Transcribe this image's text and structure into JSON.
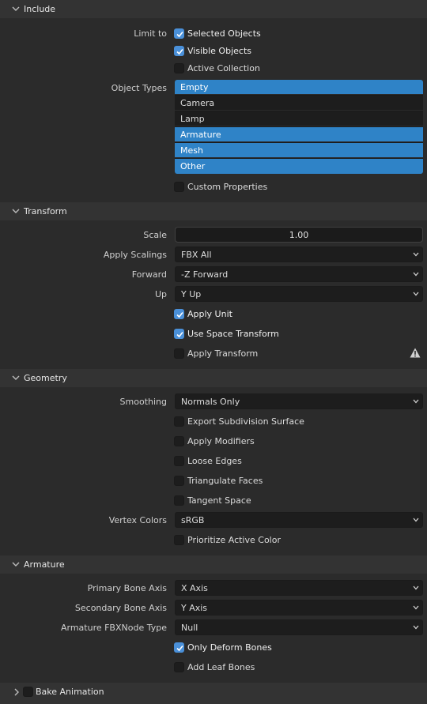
{
  "include": {
    "title": "Include",
    "limit_to_label": "Limit to",
    "selected_objects": {
      "label": "Selected Objects",
      "checked": true
    },
    "visible_objects": {
      "label": "Visible Objects",
      "checked": true
    },
    "active_collection": {
      "label": "Active Collection",
      "checked": false
    },
    "object_types_label": "Object Types",
    "object_types": [
      {
        "label": "Empty",
        "selected": true
      },
      {
        "label": "Camera",
        "selected": false
      },
      {
        "label": "Lamp",
        "selected": false
      },
      {
        "label": "Armature",
        "selected": true
      },
      {
        "label": "Mesh",
        "selected": true
      },
      {
        "label": "Other",
        "selected": true
      }
    ],
    "custom_properties": {
      "label": "Custom Properties",
      "checked": false
    }
  },
  "transform": {
    "title": "Transform",
    "scale_label": "Scale",
    "scale_value": "1.00",
    "apply_scalings_label": "Apply Scalings",
    "apply_scalings_value": "FBX All",
    "forward_label": "Forward",
    "forward_value": "-Z Forward",
    "up_label": "Up",
    "up_value": "Y Up",
    "apply_unit": {
      "label": "Apply Unit",
      "checked": true
    },
    "use_space_transform": {
      "label": "Use Space Transform",
      "checked": true
    },
    "apply_transform": {
      "label": "Apply Transform",
      "checked": false
    },
    "warning_icon": "warning-icon"
  },
  "geometry": {
    "title": "Geometry",
    "smoothing_label": "Smoothing",
    "smoothing_value": "Normals Only",
    "export_subdivision_surface": {
      "label": "Export Subdivision Surface",
      "checked": false
    },
    "apply_modifiers": {
      "label": "Apply Modifiers",
      "checked": false
    },
    "loose_edges": {
      "label": "Loose Edges",
      "checked": false
    },
    "triangulate_faces": {
      "label": "Triangulate Faces",
      "checked": false
    },
    "tangent_space": {
      "label": "Tangent Space",
      "checked": false
    },
    "vertex_colors_label": "Vertex Colors",
    "vertex_colors_value": "sRGB",
    "prioritize_active_color": {
      "label": "Prioritize Active Color",
      "checked": false
    }
  },
  "armature": {
    "title": "Armature",
    "primary_bone_axis_label": "Primary Bone Axis",
    "primary_bone_axis_value": "X Axis",
    "secondary_bone_axis_label": "Secondary Bone Axis",
    "secondary_bone_axis_value": "Y Axis",
    "fbxnode_type_label": "Armature FBXNode Type",
    "fbxnode_type_value": "Null",
    "only_deform_bones": {
      "label": "Only Deform Bones",
      "checked": true
    },
    "add_leaf_bones": {
      "label": "Add Leaf Bones",
      "checked": false
    }
  },
  "bake_animation": {
    "title": "Bake Animation",
    "checked": false,
    "expanded": false
  },
  "colors": {
    "accent": "#4a90d9",
    "selected_item": "#2f83c7",
    "panel_bg": "#2b2b2b",
    "header_bg": "#333333",
    "field_bg": "#1d1d1d"
  }
}
